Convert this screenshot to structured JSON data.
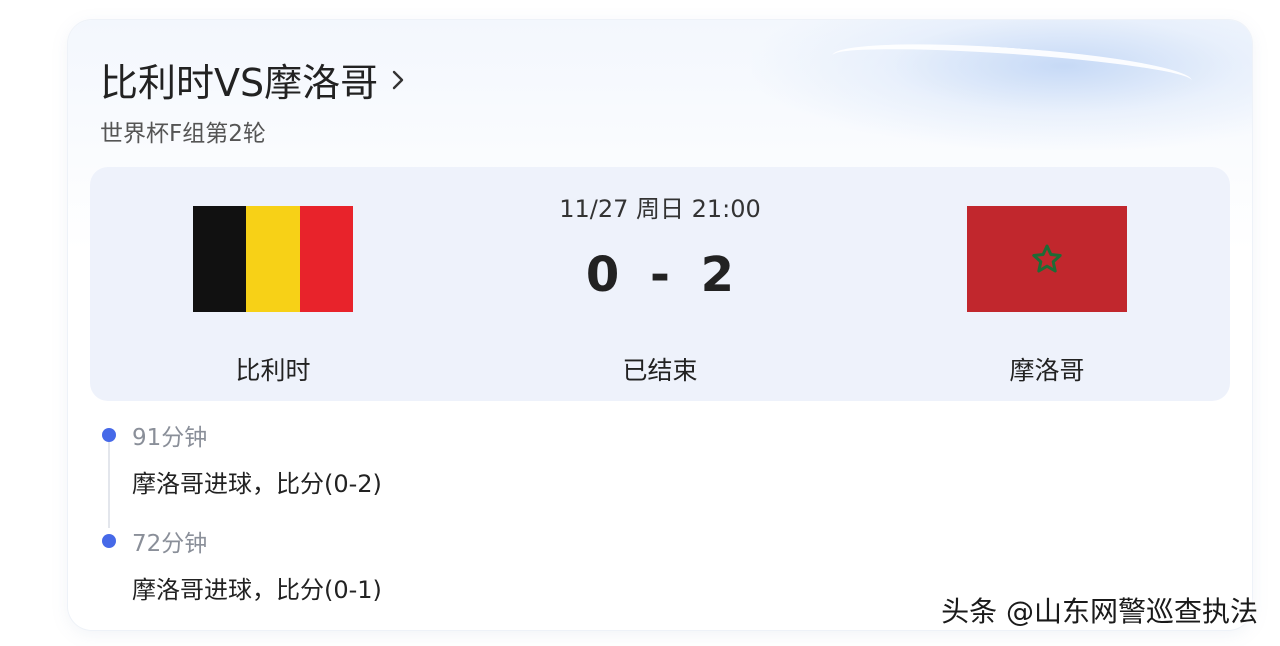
{
  "header": {
    "title": "比利时VS摩洛哥",
    "subtitle": "世界杯F组第2轮"
  },
  "match": {
    "datetime": "11/27 周日 21:00",
    "score": "0 - 2",
    "status": "已结束",
    "home": {
      "name": "比利时",
      "flag_colors": [
        "#111111",
        "#f7d117",
        "#e8232b"
      ]
    },
    "away": {
      "name": "摩洛哥",
      "flag_colors": [
        "#c1272d",
        "#1f6b35"
      ]
    }
  },
  "timeline": [
    {
      "minute": "91分钟",
      "event": "摩洛哥进球，比分(0-2)"
    },
    {
      "minute": "72分钟",
      "event": "摩洛哥进球，比分(0-1)"
    }
  ],
  "accent_color": "#4669e8",
  "watermark": "头条 @山东网警巡查执法"
}
